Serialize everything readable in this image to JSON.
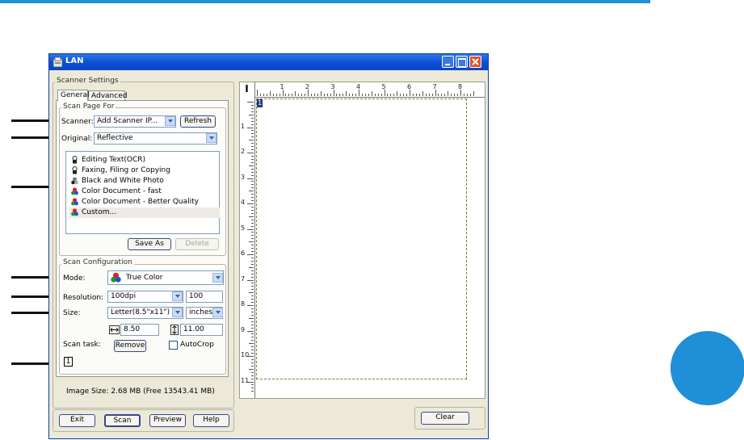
{
  "window": {
    "title": "LAN"
  },
  "scanner_settings": {
    "group_label": "Scanner Settings",
    "tabs": [
      {
        "label": "General"
      },
      {
        "label": "Advanced"
      }
    ]
  },
  "scan_page_for": {
    "group_label": "Scan Page For",
    "scanner_label": "Scanner:",
    "scanner_value": "Add Scanner IP...",
    "refresh_label": "Refresh",
    "original_label": "Original:",
    "original_value": "Reflective",
    "items": [
      {
        "label": "Editing Text(OCR)",
        "icon": "bw-document-icon"
      },
      {
        "label": "Faxing, Filing or Copying",
        "icon": "bw-document-icon"
      },
      {
        "label": "Black and White Photo",
        "icon": "bw-photo-icon"
      },
      {
        "label": "Color Document - fast",
        "icon": "color-icon"
      },
      {
        "label": "Color Document - Better Quality",
        "icon": "color-icon"
      },
      {
        "label": "Custom...",
        "icon": "color-icon"
      }
    ],
    "save_as_label": "Save As",
    "delete_label": "Delete"
  },
  "scan_configuration": {
    "group_label": "Scan Configuration",
    "mode_label": "Mode:",
    "mode_value": "True Color",
    "resolution_label": "Resolution:",
    "resolution_value": "100dpi",
    "resolution_custom": "100",
    "size_label": "Size:",
    "size_value": "Letter(8.5\"x11\")",
    "unit_value": "inches",
    "width_value": "8.50",
    "height_value": "11.00",
    "scan_task_label": "Scan task:",
    "remove_label": "Remove",
    "autocrop_label": "AutoCrop",
    "task_number": "1"
  },
  "image_size_text": "Image Size: 2.68 MB (Free 13543.41 MB)",
  "buttons": {
    "exit": "Exit",
    "scan": "Scan",
    "preview": "Preview",
    "help": "Help",
    "clear": "Clear"
  },
  "preview": {
    "ruler_h_labels": [
      "1",
      "2",
      "3",
      "4",
      "5",
      "6",
      "7",
      "8"
    ],
    "ruler_v_labels": [
      "1",
      "2",
      "3",
      "4",
      "5",
      "6",
      "7",
      "8",
      "9",
      "10",
      "11"
    ],
    "area_marker": "1"
  },
  "colors": {
    "accent_blue": "#1f8fd8",
    "titlebar": "#0a4fd6",
    "dialog_bg": "#ece9d8"
  }
}
